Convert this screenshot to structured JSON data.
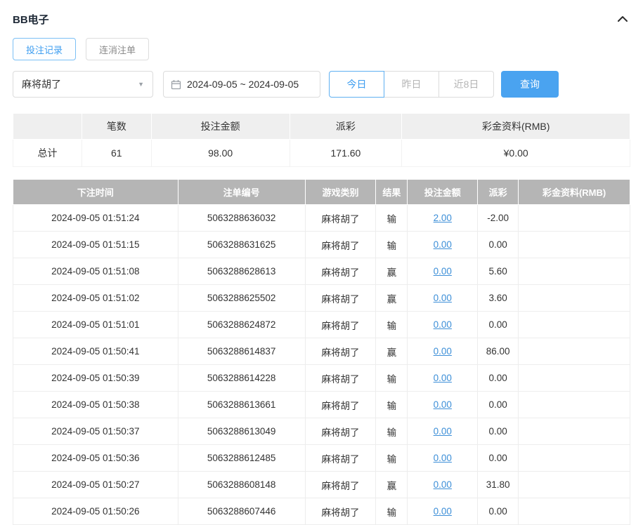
{
  "header": {
    "title": "BB电子"
  },
  "tabs": [
    {
      "label": "投注记录",
      "active": true
    },
    {
      "label": "连消注单",
      "active": false
    }
  ],
  "filters": {
    "game_select": "麻将胡了",
    "date_range": "2024-09-05 ~ 2024-09-05",
    "quick_buttons": [
      {
        "label": "今日",
        "active": true
      },
      {
        "label": "昨日",
        "active": false
      },
      {
        "label": "近8日",
        "active": false
      }
    ],
    "query_label": "查询"
  },
  "summary": {
    "headers": [
      "",
      "笔数",
      "投注金额",
      "派彩",
      "彩金资料(RMB)"
    ],
    "row": {
      "label": "总计",
      "count": "61",
      "bet_amount": "98.00",
      "payout": "171.60",
      "bonus": "¥0.00"
    }
  },
  "table": {
    "headers": [
      "下注时间",
      "注单编号",
      "游戏类别",
      "结果",
      "投注金额",
      "派彩",
      "彩金资料(RMB)"
    ],
    "rows": [
      {
        "time": "2024-09-05 01:51:24",
        "order": "5063288636032",
        "game": "麻将胡了",
        "result": "输",
        "bet": "2.00",
        "payout": "-2.00",
        "bonus": ""
      },
      {
        "time": "2024-09-05 01:51:15",
        "order": "5063288631625",
        "game": "麻将胡了",
        "result": "输",
        "bet": "0.00",
        "payout": "0.00",
        "bonus": ""
      },
      {
        "time": "2024-09-05 01:51:08",
        "order": "5063288628613",
        "game": "麻将胡了",
        "result": "赢",
        "bet": "0.00",
        "payout": "5.60",
        "bonus": ""
      },
      {
        "time": "2024-09-05 01:51:02",
        "order": "5063288625502",
        "game": "麻将胡了",
        "result": "赢",
        "bet": "0.00",
        "payout": "3.60",
        "bonus": ""
      },
      {
        "time": "2024-09-05 01:51:01",
        "order": "5063288624872",
        "game": "麻将胡了",
        "result": "输",
        "bet": "0.00",
        "payout": "0.00",
        "bonus": ""
      },
      {
        "time": "2024-09-05 01:50:41",
        "order": "5063288614837",
        "game": "麻将胡了",
        "result": "赢",
        "bet": "0.00",
        "payout": "86.00",
        "bonus": ""
      },
      {
        "time": "2024-09-05 01:50:39",
        "order": "5063288614228",
        "game": "麻将胡了",
        "result": "输",
        "bet": "0.00",
        "payout": "0.00",
        "bonus": ""
      },
      {
        "time": "2024-09-05 01:50:38",
        "order": "5063288613661",
        "game": "麻将胡了",
        "result": "输",
        "bet": "0.00",
        "payout": "0.00",
        "bonus": ""
      },
      {
        "time": "2024-09-05 01:50:37",
        "order": "5063288613049",
        "game": "麻将胡了",
        "result": "输",
        "bet": "0.00",
        "payout": "0.00",
        "bonus": ""
      },
      {
        "time": "2024-09-05 01:50:36",
        "order": "5063288612485",
        "game": "麻将胡了",
        "result": "输",
        "bet": "0.00",
        "payout": "0.00",
        "bonus": ""
      },
      {
        "time": "2024-09-05 01:50:27",
        "order": "5063288608148",
        "game": "麻将胡了",
        "result": "赢",
        "bet": "0.00",
        "payout": "31.80",
        "bonus": ""
      },
      {
        "time": "2024-09-05 01:50:26",
        "order": "5063288607446",
        "game": "麻将胡了",
        "result": "输",
        "bet": "0.00",
        "payout": "0.00",
        "bonus": ""
      }
    ]
  },
  "colors": {
    "accent_blue": "#4aa3f0",
    "link_blue": "#3d8fd8",
    "negative_red": "#e34d4d",
    "table_header_gray": "#b5b5b5"
  }
}
